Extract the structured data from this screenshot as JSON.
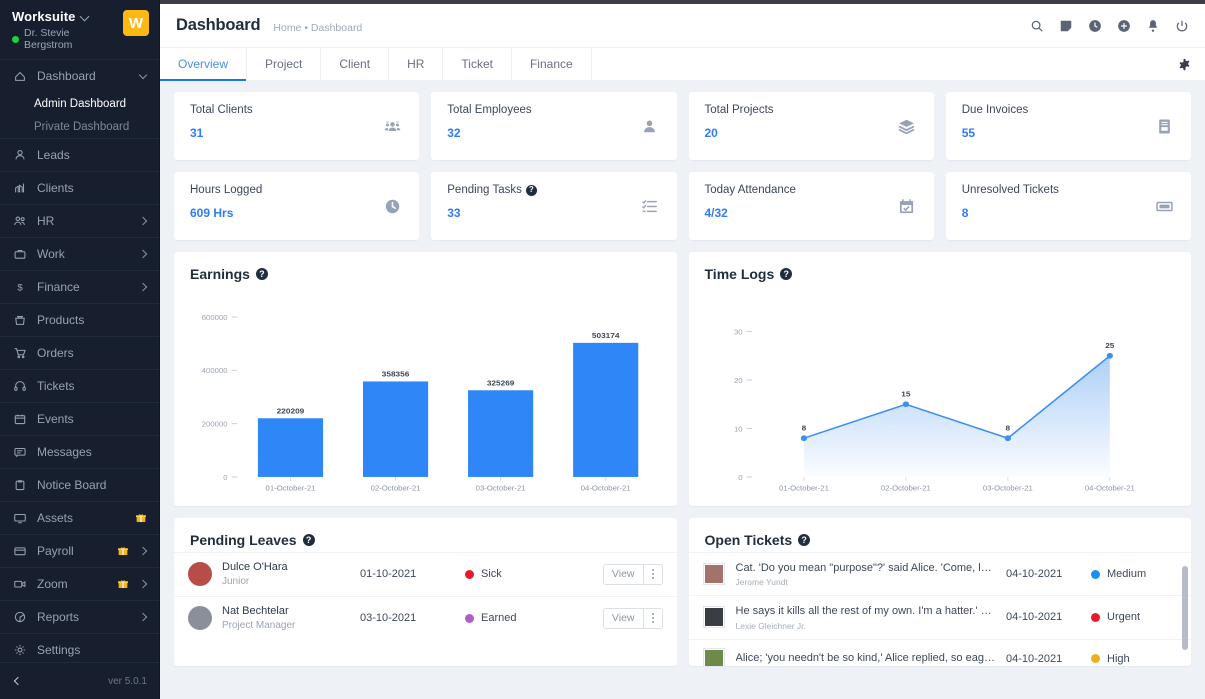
{
  "sidebar": {
    "brand": {
      "title": "Worksuite",
      "user": "Dr. Stevie Bergstrom",
      "logo_letter": "W",
      "logo_color": "#fdb913",
      "status_color": "#23cf3e"
    },
    "items": [
      {
        "label": "Dashboard",
        "icon": "home-icon",
        "caret": "down"
      },
      {
        "label": "Leads",
        "icon": "user-icon",
        "caret": ""
      },
      {
        "label": "Clients",
        "icon": "clients-icon",
        "caret": ""
      },
      {
        "label": "HR",
        "icon": "people-icon",
        "caret": "right"
      },
      {
        "label": "Work",
        "icon": "briefcase-icon",
        "caret": "right"
      },
      {
        "label": "Finance",
        "icon": "dollar-icon",
        "caret": "right"
      },
      {
        "label": "Products",
        "icon": "bag-icon",
        "caret": ""
      },
      {
        "label": "Orders",
        "icon": "cart-icon",
        "caret": ""
      },
      {
        "label": "Tickets",
        "icon": "headset-icon",
        "caret": ""
      },
      {
        "label": "Events",
        "icon": "calendar-icon",
        "caret": ""
      },
      {
        "label": "Messages",
        "icon": "chat-icon",
        "caret": ""
      },
      {
        "label": "Notice Board",
        "icon": "clipboard-icon",
        "caret": ""
      },
      {
        "label": "Assets",
        "icon": "monitor-icon",
        "caret": "",
        "gift": true
      },
      {
        "label": "Payroll",
        "icon": "wallet-icon",
        "caret": "right",
        "gift": true
      },
      {
        "label": "Zoom",
        "icon": "video-icon",
        "caret": "right",
        "gift": true
      },
      {
        "label": "Reports",
        "icon": "piechart-icon",
        "caret": "right"
      },
      {
        "label": "Settings",
        "icon": "gear-icon",
        "caret": ""
      }
    ],
    "sub_items": [
      {
        "label": "Admin Dashboard",
        "active": true
      },
      {
        "label": "Private Dashboard",
        "active": false
      }
    ],
    "version": "ver 5.0.1"
  },
  "header": {
    "title": "Dashboard",
    "breadcrumb": "Home • Dashboard",
    "icons": [
      "search-icon",
      "note-icon",
      "clock-icon",
      "plus-circle-icon",
      "bell-icon",
      "power-icon"
    ],
    "settings_icon": "gear-icon"
  },
  "tabs": [
    {
      "label": "Overview",
      "active": true
    },
    {
      "label": "Project",
      "active": false
    },
    {
      "label": "Client",
      "active": false
    },
    {
      "label": "HR",
      "active": false
    },
    {
      "label": "Ticket",
      "active": false
    },
    {
      "label": "Finance",
      "active": false
    }
  ],
  "stats": [
    {
      "title": "Total Clients",
      "value": "31",
      "icon": "group-icon",
      "help": false
    },
    {
      "title": "Total Employees",
      "value": "32",
      "icon": "person-icon",
      "help": false
    },
    {
      "title": "Total Projects",
      "value": "20",
      "icon": "layers-icon",
      "help": false
    },
    {
      "title": "Due Invoices",
      "value": "55",
      "icon": "invoice-icon",
      "help": false
    },
    {
      "title": "Hours Logged",
      "value": "609 Hrs",
      "icon": "clock-filled-icon",
      "help": false
    },
    {
      "title": "Pending Tasks",
      "value": "33",
      "icon": "tasklist-icon",
      "help": true
    },
    {
      "title": "Today Attendance",
      "value": "4/32",
      "icon": "calendar-check-icon",
      "help": false
    },
    {
      "title": "Unresolved Tickets",
      "value": "8",
      "icon": "ticket-icon",
      "help": false
    }
  ],
  "earnings_panel": {
    "title": "Earnings",
    "help": true
  },
  "timelogs_panel": {
    "title": "Time Logs",
    "help": true
  },
  "chart_data": [
    {
      "type": "bar",
      "title": "Earnings",
      "categories": [
        "01-October-21",
        "02-October-21",
        "03-October-21",
        "04-October-21"
      ],
      "values": [
        220209,
        358356,
        325269,
        503174
      ],
      "value_labels": [
        "220209",
        "358356",
        "325269",
        "503174"
      ],
      "ytick_labels": [
        "0",
        "200000",
        "400000",
        "600000"
      ],
      "yticks": [
        0,
        200000,
        400000,
        600000
      ],
      "ylim": [
        0,
        600000
      ],
      "xlabel": "",
      "ylabel": "",
      "grid": false,
      "legend": false,
      "bar_color": "#2f86f6"
    },
    {
      "type": "area",
      "title": "Time Logs",
      "categories": [
        "01-October-21",
        "02-October-21",
        "03-October-21",
        "04-October-21"
      ],
      "values": [
        8,
        15,
        8,
        25
      ],
      "value_labels": [
        "8",
        "15",
        "8",
        "25"
      ],
      "ytick_labels": [
        "0",
        "10",
        "20",
        "30"
      ],
      "yticks": [
        0,
        10,
        20,
        30
      ],
      "ylim": [
        0,
        33
      ],
      "xlabel": "",
      "ylabel": "",
      "grid": false,
      "legend": false,
      "line_color": "#3f8ef0",
      "fill_color": "#a9cdf7"
    }
  ],
  "pending_leaves": {
    "title": "Pending Leaves",
    "help": true,
    "view_label": "View",
    "rows": [
      {
        "name": "Dulce O'Hara",
        "role": "Junior",
        "date": "01-10-2021",
        "type": "Sick",
        "dot_color": "#e8192c",
        "avatar_color": "#b64d48"
      },
      {
        "name": "Nat Bechtelar",
        "role": "Project Manager",
        "date": "03-10-2021",
        "type": "Earned",
        "dot_color": "#b05ccb",
        "avatar_color": "#8a8f99"
      }
    ]
  },
  "open_tickets": {
    "title": "Open Tickets",
    "help": true,
    "rows": [
      {
        "subject": "Cat. 'Do you mean \"purpose\"?' said Alice. 'Come, let's try the.",
        "user": "Jerome Yundt",
        "date": "04-10-2021",
        "priority": "Medium",
        "dot_color": "#1a8ff5",
        "avatar_color": "#a3736b"
      },
      {
        "subject": "He says it kills all the rest of my own. I'm a hatter.' Here the.",
        "user": "Lexie Gleichner Jr.",
        "date": "04-10-2021",
        "priority": "Urgent",
        "dot_color": "#e8192c",
        "avatar_color": "#3a3d44"
      },
      {
        "subject": "Alice; 'you needn't be so kind,' Alice replied, so eagerly that the.",
        "user": "",
        "date": "04-10-2021",
        "priority": "High",
        "dot_color": "#f0ad1e",
        "avatar_color": "#6d8a4a"
      }
    ]
  }
}
